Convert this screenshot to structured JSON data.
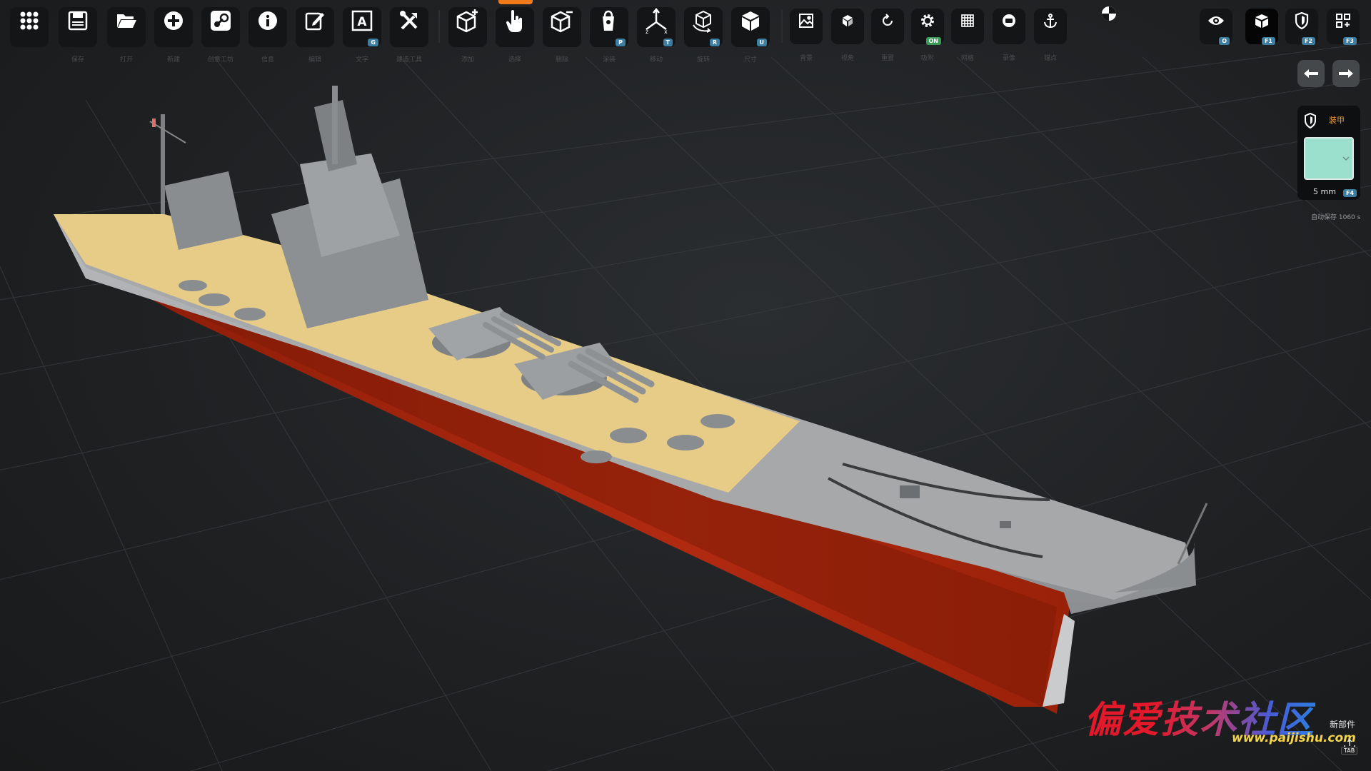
{
  "toolbar": {
    "buttons": [
      {
        "id": "apps",
        "label": "",
        "icon": "apps-grid-icon",
        "badge": ""
      },
      {
        "id": "save",
        "label": "保存",
        "icon": "save-icon",
        "badge": ""
      },
      {
        "id": "open",
        "label": "打开",
        "icon": "folder-open-icon",
        "badge": ""
      },
      {
        "id": "new",
        "label": "新建",
        "icon": "plus-circle-icon",
        "badge": ""
      },
      {
        "id": "steam",
        "label": "创意工坊",
        "icon": "steam-icon",
        "badge": ""
      },
      {
        "id": "info",
        "label": "信息",
        "icon": "info-icon",
        "badge": ""
      },
      {
        "id": "edit",
        "label": "编辑",
        "icon": "edit-icon",
        "badge": ""
      },
      {
        "id": "text",
        "label": "文字",
        "icon": "text-a-icon",
        "badge": "G"
      },
      {
        "id": "tools",
        "label": "建造工具",
        "icon": "tools-icon",
        "badge": ""
      },
      {
        "id": "add-part",
        "label": "添加",
        "icon": "cube-add-icon",
        "badge": ""
      },
      {
        "id": "select",
        "label": "选择",
        "icon": "hand-pointer-icon",
        "badge": ""
      },
      {
        "id": "remove-part",
        "label": "删除",
        "icon": "cube-remove-icon",
        "badge": ""
      },
      {
        "id": "paint",
        "label": "涂装",
        "icon": "paint-bucket-icon",
        "badge": "P"
      },
      {
        "id": "move",
        "label": "移动",
        "icon": "axis-move-icon",
        "badge": "T"
      },
      {
        "id": "rotate",
        "label": "旋转",
        "icon": "rotate-cube-icon",
        "badge": "R"
      },
      {
        "id": "size",
        "label": "尺寸",
        "icon": "solid-cube-icon",
        "badge": "U"
      }
    ],
    "small_buttons": [
      {
        "id": "background",
        "label": "背景",
        "icon": "image-icon",
        "badge": ""
      },
      {
        "id": "view-cube",
        "label": "视角",
        "icon": "small-cube-icon",
        "badge": ""
      },
      {
        "id": "reset",
        "label": "重置",
        "icon": "refresh-icon",
        "badge": ""
      },
      {
        "id": "snap",
        "label": "吸附",
        "icon": "gear-icon",
        "badge": "ON"
      },
      {
        "id": "grid",
        "label": "网格",
        "icon": "grid-icon",
        "badge": ""
      },
      {
        "id": "record",
        "label": "录像",
        "icon": "record-icon",
        "badge": ""
      },
      {
        "id": "anchor",
        "label": "锚点",
        "icon": "anchor-icon",
        "badge": ""
      }
    ],
    "view_modes": [
      {
        "id": "visibility",
        "icon": "eye-icon",
        "badge": "O"
      },
      {
        "id": "model",
        "icon": "cube-mode-icon",
        "badge": "F1"
      },
      {
        "id": "armor",
        "icon": "shield-icon",
        "badge": "F2"
      },
      {
        "id": "layout",
        "icon": "layout-icon",
        "badge": "F3"
      }
    ]
  },
  "material": {
    "label": "装甲",
    "thickness": "5 mm",
    "hotkey": "F4",
    "swatch_color": "#9be0cc"
  },
  "autosave": "自动保存 1060 s",
  "new_part": "新部件",
  "tab_key": "TAB",
  "watermark": {
    "text": "偏爱技术社区",
    "url": "www.paijishu.com"
  },
  "colors": {
    "hull_red": "#a8260e",
    "hull_grey": "#9a9c9e",
    "deck_wood": "#e9cf8a",
    "accent": "#f07a1a"
  }
}
